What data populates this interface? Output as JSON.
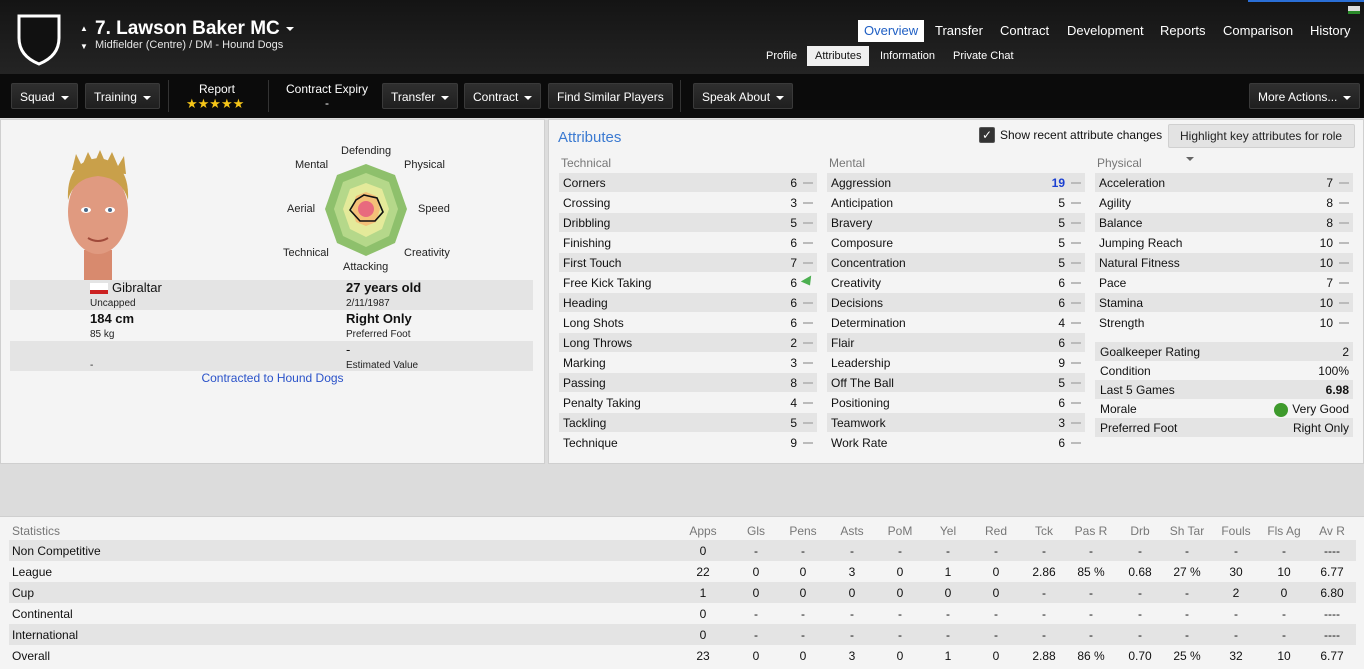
{
  "header": {
    "player_name": "7. Lawson Baker MC",
    "position": "Midfielder (Centre) / DM - Hound Dogs",
    "tabs": [
      "Overview",
      "Transfer",
      "Contract",
      "Development",
      "Reports",
      "Comparison",
      "History"
    ],
    "subtabs": [
      "Profile",
      "Attributes",
      "Information",
      "Private Chat"
    ]
  },
  "toolbar": {
    "squad": "Squad",
    "training": "Training",
    "report_label": "Report",
    "stars": "★★★★★",
    "contract_expiry_label": "Contract Expiry",
    "contract_expiry_value": "-",
    "transfer": "Transfer",
    "contract": "Contract",
    "find_similar": "Find Similar Players",
    "speak_about": "Speak About",
    "more_actions": "More Actions..."
  },
  "profile": {
    "radar_labels": {
      "top": "Defending",
      "tl": "Mental",
      "tr": "Physical",
      "l": "Aerial",
      "r": "Speed",
      "bl": "Technical",
      "br": "Creativity",
      "bottom": "Attacking"
    },
    "nation": "Gibraltar",
    "caps": "Uncapped",
    "age": "27 years old",
    "dob": "2/11/1987",
    "height": "184 cm",
    "weight": "85 kg",
    "foot": "Right Only",
    "foot_label": "Preferred Foot",
    "value_left": "-",
    "value": "-",
    "value_label": "Estimated Value",
    "contracted": "Contracted to Hound Dogs"
  },
  "attributes": {
    "title": "Attributes",
    "show_changes": "Show recent attribute changes",
    "highlight": "Highlight key attributes for role",
    "technical_label": "Technical",
    "mental_label": "Mental",
    "physical_label": "Physical",
    "technical": [
      {
        "name": "Corners",
        "value": "6"
      },
      {
        "name": "Crossing",
        "value": "3"
      },
      {
        "name": "Dribbling",
        "value": "5"
      },
      {
        "name": "Finishing",
        "value": "6"
      },
      {
        "name": "First Touch",
        "value": "7"
      },
      {
        "name": "Free Kick Taking",
        "value": "6"
      },
      {
        "name": "Heading",
        "value": "6"
      },
      {
        "name": "Long Shots",
        "value": "6"
      },
      {
        "name": "Long Throws",
        "value": "2"
      },
      {
        "name": "Marking",
        "value": "3"
      },
      {
        "name": "Passing",
        "value": "8"
      },
      {
        "name": "Penalty Taking",
        "value": "4"
      },
      {
        "name": "Tackling",
        "value": "5"
      },
      {
        "name": "Technique",
        "value": "9"
      }
    ],
    "mental": [
      {
        "name": "Aggression",
        "value": "19"
      },
      {
        "name": "Anticipation",
        "value": "5"
      },
      {
        "name": "Bravery",
        "value": "5"
      },
      {
        "name": "Composure",
        "value": "5"
      },
      {
        "name": "Concentration",
        "value": "5"
      },
      {
        "name": "Creativity",
        "value": "6"
      },
      {
        "name": "Decisions",
        "value": "6"
      },
      {
        "name": "Determination",
        "value": "4"
      },
      {
        "name": "Flair",
        "value": "6"
      },
      {
        "name": "Leadership",
        "value": "9"
      },
      {
        "name": "Off The Ball",
        "value": "5"
      },
      {
        "name": "Positioning",
        "value": "6"
      },
      {
        "name": "Teamwork",
        "value": "3"
      },
      {
        "name": "Work Rate",
        "value": "6"
      }
    ],
    "physical": [
      {
        "name": "Acceleration",
        "value": "7"
      },
      {
        "name": "Agility",
        "value": "8"
      },
      {
        "name": "Balance",
        "value": "8"
      },
      {
        "name": "Jumping Reach",
        "value": "10"
      },
      {
        "name": "Natural Fitness",
        "value": "10"
      },
      {
        "name": "Pace",
        "value": "7"
      },
      {
        "name": "Stamina",
        "value": "10"
      },
      {
        "name": "Strength",
        "value": "10"
      }
    ],
    "other": [
      {
        "name": "Goalkeeper Rating",
        "value": "2"
      },
      {
        "name": "Condition",
        "value": "100%"
      },
      {
        "name": "Last 5 Games",
        "value": "6.98"
      },
      {
        "name": "Morale",
        "value": "Very Good"
      },
      {
        "name": "Preferred Foot",
        "value": "Right Only"
      }
    ]
  },
  "statistics": {
    "columns": [
      "Statistics",
      "Apps",
      "Gls",
      "Pens",
      "Asts",
      "PoM",
      "Yel",
      "Red",
      "Tck",
      "Pas R",
      "Drb",
      "Sh Tar",
      "Fouls",
      "Fls Ag",
      "Av R"
    ],
    "rows": [
      [
        "Non Competitive",
        "0",
        "-",
        "-",
        "-",
        "-",
        "-",
        "-",
        "-",
        "-",
        "-",
        "-",
        "-",
        "-",
        "----"
      ],
      [
        "League",
        "22",
        "0",
        "0",
        "3",
        "0",
        "1",
        "0",
        "2.86",
        "85 %",
        "0.68",
        "27 %",
        "30",
        "10",
        "6.77"
      ],
      [
        "Cup",
        "1",
        "0",
        "0",
        "0",
        "0",
        "0",
        "0",
        "-",
        "-",
        "-",
        "-",
        "2",
        "0",
        "6.80"
      ],
      [
        "Continental",
        "0",
        "-",
        "-",
        "-",
        "-",
        "-",
        "-",
        "-",
        "-",
        "-",
        "-",
        "-",
        "-",
        "----"
      ],
      [
        "International",
        "0",
        "-",
        "-",
        "-",
        "-",
        "-",
        "-",
        "-",
        "-",
        "-",
        "-",
        "-",
        "-",
        "----"
      ],
      [
        "Overall",
        "23",
        "0",
        "0",
        "3",
        "0",
        "1",
        "0",
        "2.88",
        "86 %",
        "0.70",
        "25 %",
        "32",
        "10",
        "6.77"
      ]
    ]
  },
  "colors": {
    "accent": "#3b7ad1",
    "aggression": "#1a3fd1",
    "link": "#2a52c9"
  }
}
